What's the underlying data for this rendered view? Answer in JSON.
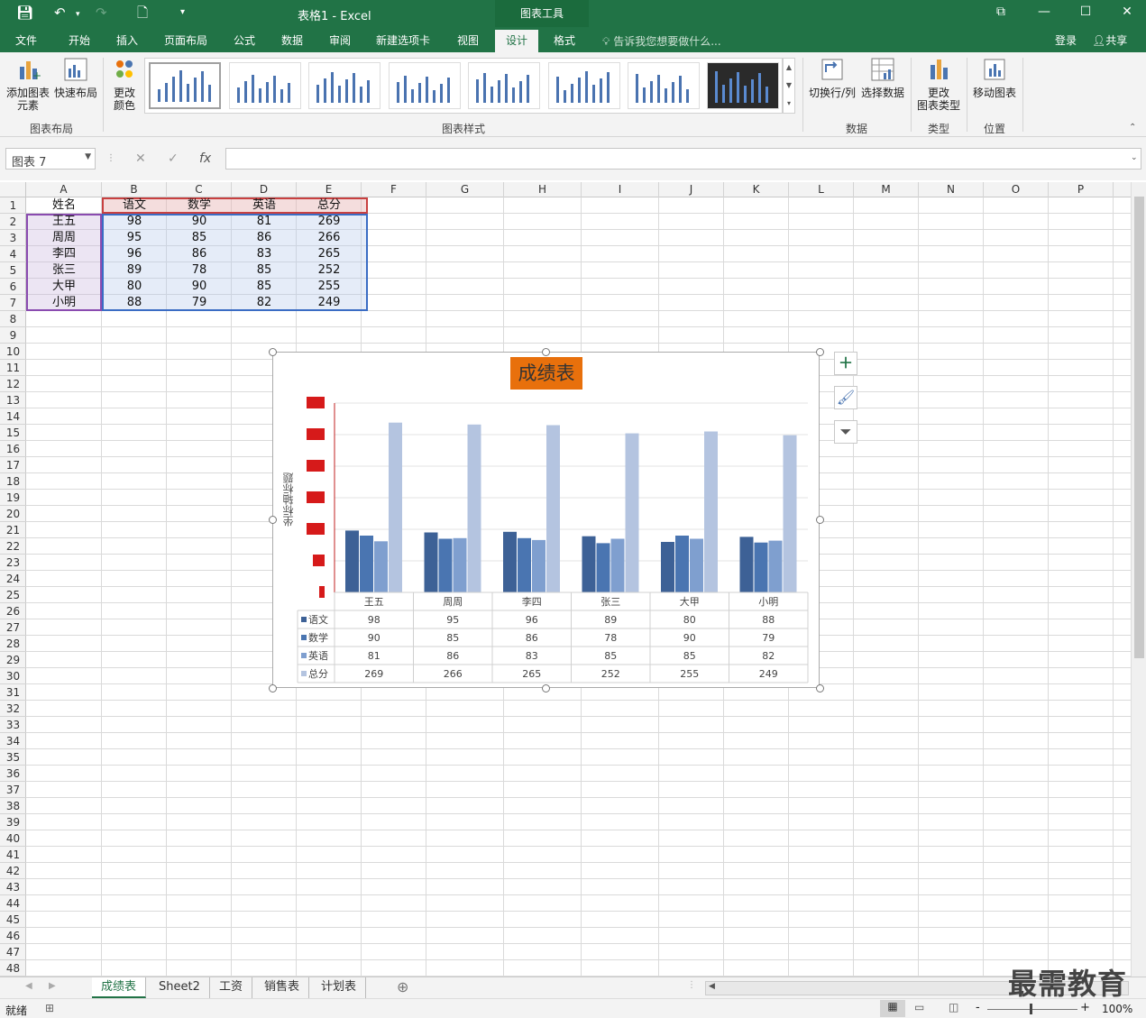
{
  "titlebar": {
    "doc_title": "表格1 - Excel",
    "context_tool": "图表工具",
    "icons": [
      "save-icon",
      "undo-icon",
      "redo-icon",
      "new-icon",
      "customize-icon"
    ],
    "window": [
      "ribbon-options-icon",
      "minimize-icon",
      "maximize-icon",
      "close-icon"
    ]
  },
  "menu": {
    "items": [
      "文件",
      "开始",
      "插入",
      "页面布局",
      "公式",
      "数据",
      "审阅",
      "新建选项卡",
      "视图",
      "设计",
      "格式"
    ],
    "active": "设计",
    "tell_me": "告诉我您想要做什么...",
    "login": "登录",
    "share": "共享"
  },
  "ribbon": {
    "add_chart_element": "添加图表\n元素",
    "quick_layout": "快速布局",
    "group_layout": "图表布局",
    "change_colors": "更改\n颜色",
    "group_styles": "图表样式",
    "switch_row_col": "切换行/列",
    "select_data": "选择数据",
    "group_data": "数据",
    "change_type": "更改\n图表类型",
    "group_type": "类型",
    "move_chart": "移动图表",
    "group_location": "位置"
  },
  "formula_bar": {
    "name_box": "图表 7",
    "cancel": "✕",
    "enter": "✓",
    "fx": "fx",
    "value": ""
  },
  "columns": [
    "A",
    "B",
    "C",
    "D",
    "E",
    "F",
    "G",
    "H",
    "I",
    "J",
    "K",
    "L",
    "M",
    "N",
    "O",
    "P"
  ],
  "rows": [
    "1",
    "2",
    "3",
    "4",
    "5",
    "6",
    "7",
    "8",
    "9",
    "10",
    "11",
    "12",
    "13",
    "14",
    "15",
    "16",
    "17",
    "18",
    "19",
    "20",
    "21",
    "22",
    "23",
    "24",
    "25",
    "26",
    "27",
    "28",
    "29",
    "30",
    "31",
    "32",
    "33",
    "34",
    "35",
    "36",
    "37",
    "38",
    "39",
    "40",
    "41",
    "42",
    "43",
    "44",
    "45",
    "46",
    "47",
    "48"
  ],
  "table": {
    "header": [
      "姓名",
      "语文",
      "数学",
      "英语",
      "总分"
    ],
    "rows": [
      [
        "王五",
        "98",
        "90",
        "81",
        "269"
      ],
      [
        "周周",
        "95",
        "85",
        "86",
        "266"
      ],
      [
        "李四",
        "96",
        "86",
        "83",
        "265"
      ],
      [
        "张三",
        "89",
        "78",
        "85",
        "252"
      ],
      [
        "大甲",
        "80",
        "90",
        "85",
        "255"
      ],
      [
        "小明",
        "88",
        "79",
        "82",
        "249"
      ]
    ]
  },
  "chart_data": {
    "type": "bar",
    "title": "成绩表",
    "ylabel": "坐标轴标题",
    "xlabel": "",
    "categories": [
      "王五",
      "周周",
      "李四",
      "张三",
      "大甲",
      "小明"
    ],
    "series": [
      {
        "name": "语文",
        "values": [
          98,
          95,
          96,
          89,
          80,
          88
        ],
        "color": "#3d6196"
      },
      {
        "name": "数学",
        "values": [
          90,
          85,
          86,
          78,
          90,
          79
        ],
        "color": "#4a75b1"
      },
      {
        "name": "英语",
        "values": [
          81,
          86,
          83,
          85,
          85,
          82
        ],
        "color": "#7f9fcf"
      },
      {
        "name": "总分",
        "values": [
          269,
          266,
          265,
          252,
          255,
          249
        ],
        "color": "#b4c4e0"
      }
    ],
    "ylim": [
      0,
      300
    ],
    "grid": true,
    "legend": "data-table",
    "title_bg": "#e8700c",
    "tick_label_bg": "#d61a1a"
  },
  "chart_side_buttons": [
    "add-element-icon",
    "brush-style-icon",
    "filter-icon"
  ],
  "sheets": {
    "tabs": [
      "成绩表",
      "Sheet2",
      "工资",
      "销售表",
      "计划表"
    ],
    "active": "成绩表",
    "add": "⊕"
  },
  "status": {
    "ready": "就绪",
    "zoom": "100%",
    "zoom_minus": "-",
    "zoom_plus": "+"
  },
  "watermark": "最需教育"
}
